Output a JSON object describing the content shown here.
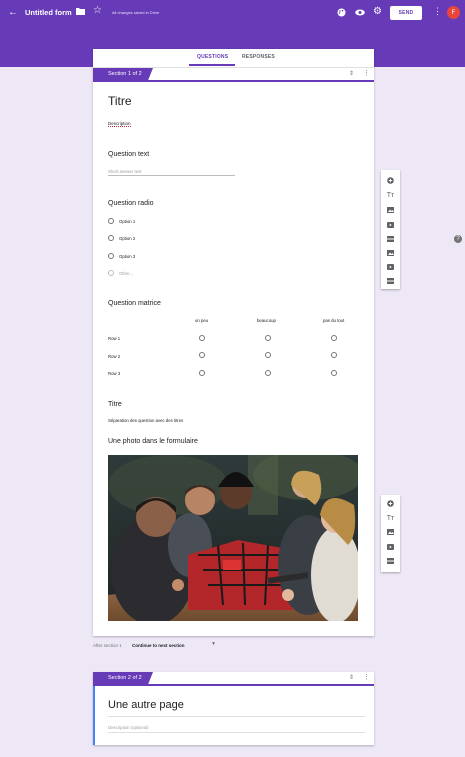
{
  "header": {
    "title": "Untitled form",
    "saved_status": "All changes saved in Drive",
    "send_label": "SEND",
    "avatar_letter": "F"
  },
  "tabs": {
    "questions": "QUESTIONS",
    "responses": "RESPONSES"
  },
  "section1": {
    "badge": "Section 1 of 2",
    "title": "Titre",
    "description": "Description",
    "q_text": {
      "title": "Question text",
      "placeholder": "Short answer text"
    },
    "q_radio": {
      "title": "Question radio",
      "options": [
        "Option 1",
        "Option 2",
        "Option 3"
      ],
      "other": "Other..."
    },
    "q_matrix": {
      "title": "Question matrice",
      "columns": [
        "un peu",
        "beaucoup",
        "pas du tout"
      ],
      "rows": [
        "Row 1",
        "Row 2",
        "Row 3"
      ]
    },
    "title_block": {
      "title": "Titre",
      "description": "Séparation des question avec des titres"
    },
    "image_block": {
      "title": "Une photo dans le formulaire"
    }
  },
  "after_section": {
    "label": "After section 1",
    "value": "Continue to next section"
  },
  "section2": {
    "badge": "Section 2 of 2",
    "title": "Une autre page",
    "description_placeholder": "Description (optional)"
  },
  "colors": {
    "brand": "#673ab7",
    "background": "#ede7f6",
    "avatar": "#e8453c"
  }
}
